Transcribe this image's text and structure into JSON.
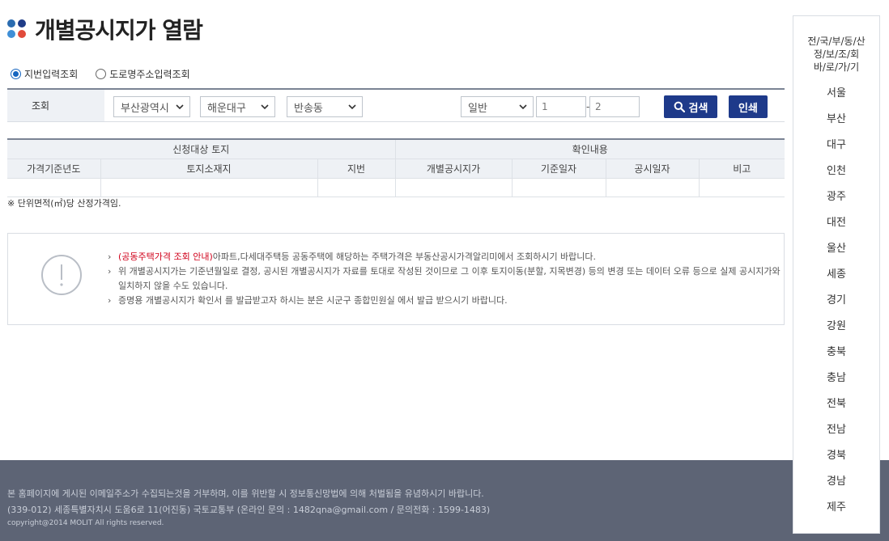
{
  "page": {
    "title": "개별공시지가 열람"
  },
  "search_mode": {
    "options": [
      {
        "label": "지번입력조회",
        "selected": true
      },
      {
        "label": "도로명주소입력조회",
        "selected": false
      }
    ]
  },
  "search": {
    "label": "조회",
    "sido": "부산광역시",
    "sigungu": "해운대구",
    "dong": "반송동",
    "land_type": "일반",
    "bonbun": "1",
    "bubun": "2",
    "separator": "-",
    "search_button": "검색",
    "print_button": "인쇄"
  },
  "table": {
    "group_headers": [
      "신청대상 토지",
      "확인내용"
    ],
    "columns": [
      "가격기준년도",
      "토지소재지",
      "지번",
      "개별공시지가",
      "기준일자",
      "공시일자",
      "비고"
    ]
  },
  "unit_note": "※ 단위면적(㎡)당 산정가격임.",
  "notices": {
    "item1_link": "(공동주택가격 조회 안내)",
    "item1_text": "아파트,다세대주택등 공동주택에 해당하는 주택가격은 부동산공시가격알리미에서 조회하시기 바랍니다.",
    "item2_line1": "위 개별공시지가는 기준년월일로 결정, 공시된 개별공시지가 자료를 토대로 작성된 것이므로 그 이후 토지이동(분할, 지목변경) 등의 변경 또는 데이터 오류 등으로 실제 공시지가와",
    "item2_line2": "일치하지 않을 수도 있습니다.",
    "item3": "증명용 개별공시지가 확인서 를 발급받고자 하시는 분은 시군구 종합민원실 에서 발급 받으시기 바랍니다."
  },
  "footer": {
    "line1": "본 홈페이지에 게시된 이메일주소가 수집되는것을 거부하며, 이를 위반할 시 정보통신망법에 의해 처벌됨을 유념하시기 바랍니다.",
    "line2": "(339-012) 세종특별자치시 도움6로 11(어진동) 국토교통부 (온라인 문의 : 1482qna@gmail.com / 문의전화 : 1599-1483)",
    "line3": "copyright@2014 MOLIT All rights reserved."
  },
  "region_panel": {
    "title_lines": [
      "전/국/부/동/산",
      "정/보/조/회",
      "바/로/가/기"
    ],
    "regions": [
      "서울",
      "부산",
      "대구",
      "인천",
      "광주",
      "대전",
      "울산",
      "세종",
      "경기",
      "강원",
      "충북",
      "충남",
      "전북",
      "전남",
      "경북",
      "경남",
      "제주"
    ]
  },
  "colors": {
    "primary_button": "#1e3a8a",
    "notice_red": "#d0021b",
    "footer_bg": "#5d6475",
    "radio_active": "#1565c0"
  },
  "icons": {
    "title": "four-dots-icon",
    "search": "magnifier-icon",
    "select": "chevron-down-icon",
    "notice": "exclamation-circle-icon"
  }
}
